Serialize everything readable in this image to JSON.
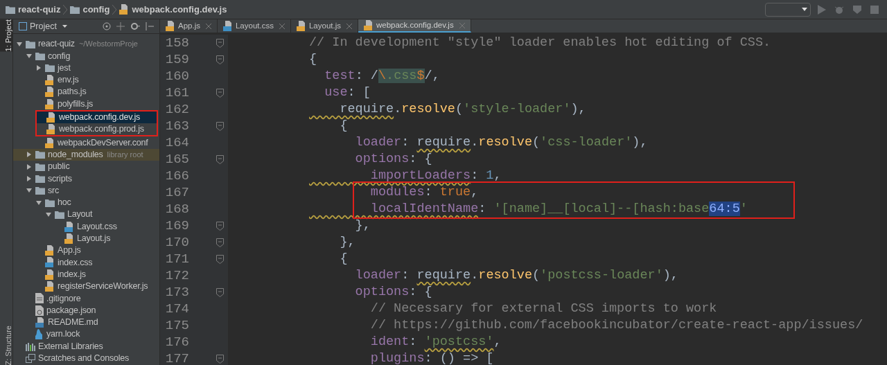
{
  "breadcrumbs": [
    {
      "label": "react-quiz",
      "kind": "folder"
    },
    {
      "label": "config",
      "kind": "folder"
    },
    {
      "label": "webpack.config.dev.js",
      "kind": "js"
    }
  ],
  "tool_strip": [
    {
      "label": "1: Project",
      "selected": true
    },
    {
      "label": "Z: Structure",
      "selected": false
    }
  ],
  "project_panel": {
    "title": "Project"
  },
  "tree": [
    {
      "label": "react-quiz",
      "kind": "folder",
      "expanded": true,
      "note": "~/WebstormProje",
      "children": [
        {
          "label": "config",
          "kind": "folder",
          "expanded": true,
          "children": [
            {
              "label": "jest",
              "kind": "folder",
              "expanded": false
            },
            {
              "label": "env.js",
              "kind": "js"
            },
            {
              "label": "paths.js",
              "kind": "js"
            },
            {
              "label": "polyfills.js",
              "kind": "js"
            },
            {
              "label": "webpack.config.dev.js",
              "kind": "js",
              "selected": true,
              "boxed": true
            },
            {
              "label": "webpack.config.prod.js",
              "kind": "js",
              "selected": false,
              "boxed": true
            },
            {
              "label": "webpackDevServer.conf",
              "kind": "js"
            }
          ]
        },
        {
          "label": "node_modules",
          "kind": "folder",
          "expanded": false,
          "note": "library root",
          "library": true
        },
        {
          "label": "public",
          "kind": "folder",
          "expanded": false,
          "library": false
        },
        {
          "label": "scripts",
          "kind": "folder",
          "expanded": false,
          "library": false
        },
        {
          "label": "src",
          "kind": "folder",
          "expanded": true,
          "children": [
            {
              "label": "hoc",
              "kind": "folder",
              "expanded": true,
              "children": [
                {
                  "label": "Layout",
                  "kind": "folder",
                  "expanded": true,
                  "children": [
                    {
                      "label": "Layout.css",
                      "kind": "css"
                    },
                    {
                      "label": "Layout.js",
                      "kind": "js"
                    }
                  ]
                }
              ]
            },
            {
              "label": "App.js",
              "kind": "js"
            },
            {
              "label": "index.css",
              "kind": "css"
            },
            {
              "label": "index.js",
              "kind": "js"
            },
            {
              "label": "registerServiceWorker.js",
              "kind": "js"
            }
          ]
        },
        {
          "label": ".gitignore",
          "kind": "text"
        },
        {
          "label": "package.json",
          "kind": "json"
        },
        {
          "label": "README.md",
          "kind": "md"
        },
        {
          "label": "yarn.lock",
          "kind": "yarn"
        }
      ]
    },
    {
      "label": "External Libraries",
      "kind": "libs"
    },
    {
      "label": "Scratches and Consoles",
      "kind": "scratches"
    }
  ],
  "tabs": [
    {
      "label": "App.js",
      "kind": "js",
      "selected": false
    },
    {
      "label": "Layout.css",
      "kind": "css",
      "selected": false
    },
    {
      "label": "Layout.js",
      "kind": "js",
      "selected": false
    },
    {
      "label": "webpack.config.dev.js",
      "kind": "js",
      "selected": true
    }
  ],
  "code": [
    {
      "number": "158",
      "fold": true,
      "tokens": [
        {
          "t": "// In development \"style\" loader enables hot editing of CSS.",
          "kind": "comment"
        }
      ]
    },
    {
      "number": "159",
      "fold": true,
      "tokens": [
        {
          "t": "{",
          "kind": "p"
        }
      ]
    },
    {
      "number": "160",
      "fold": false,
      "tokens": [
        {
          "t": "  test",
          "kind": "key"
        },
        {
          "t": ": /",
          "kind": "p"
        },
        {
          "t": "\\",
          "kind": "esc",
          "hl": true
        },
        {
          "t": ".css",
          "kind": "str",
          "hl": true
        },
        {
          "t": "$",
          "kind": "esc",
          "hl": true
        },
        {
          "t": "/,",
          "kind": "p"
        }
      ]
    },
    {
      "number": "161",
      "fold": true,
      "tokens": [
        {
          "t": "  use",
          "kind": "key"
        },
        {
          "t": ": [",
          "kind": "p"
        }
      ]
    },
    {
      "number": "162",
      "fold": false,
      "tokens": [
        {
          "t": "    require",
          "kind": "p",
          "squiggle": true
        },
        {
          "t": ".",
          "kind": "p"
        },
        {
          "t": "resolve",
          "kind": "fn"
        },
        {
          "t": "(",
          "kind": "p"
        },
        {
          "t": "'style-loader'",
          "kind": "str"
        },
        {
          "t": "),",
          "kind": "p"
        }
      ]
    },
    {
      "number": "163",
      "fold": true,
      "tokens": [
        {
          "t": "    {",
          "kind": "p"
        }
      ]
    },
    {
      "number": "164",
      "fold": false,
      "tokens": [
        {
          "t": "      loader",
          "kind": "key"
        },
        {
          "t": ": ",
          "kind": "p"
        },
        {
          "t": "require",
          "kind": "p",
          "squiggle": true
        },
        {
          "t": ".",
          "kind": "p"
        },
        {
          "t": "resolve",
          "kind": "fn"
        },
        {
          "t": "(",
          "kind": "p"
        },
        {
          "t": "'css-loader'",
          "kind": "str"
        },
        {
          "t": "),",
          "kind": "p"
        }
      ]
    },
    {
      "number": "165",
      "fold": true,
      "tokens": [
        {
          "t": "      options",
          "kind": "key"
        },
        {
          "t": ": {",
          "kind": "p"
        }
      ]
    },
    {
      "number": "166",
      "fold": false,
      "tokens": [
        {
          "t": "        importLoaders",
          "kind": "key",
          "squiggle": true
        },
        {
          "t": ": ",
          "kind": "p"
        },
        {
          "t": "1",
          "kind": "num"
        },
        {
          "t": ",",
          "kind": "p"
        }
      ]
    },
    {
      "number": "167",
      "fold": false,
      "boxed": true,
      "tokens": [
        {
          "t": "        modules",
          "kind": "key"
        },
        {
          "t": ": ",
          "kind": "p"
        },
        {
          "t": "true",
          "kind": "kw"
        },
        {
          "t": ",",
          "kind": "p"
        }
      ]
    },
    {
      "number": "168",
      "fold": false,
      "boxed": true,
      "tokens": [
        {
          "t": "        localIdentName",
          "kind": "key",
          "squiggle": true
        },
        {
          "t": ": ",
          "kind": "p"
        },
        {
          "t": "'[name]__[local]--[hash:base",
          "kind": "str"
        },
        {
          "t": "64:5",
          "kind": "str",
          "selected": true
        },
        {
          "t": "'",
          "kind": "str"
        }
      ]
    },
    {
      "number": "169",
      "fold": true,
      "tokens": [
        {
          "t": "      },",
          "kind": "p"
        }
      ]
    },
    {
      "number": "170",
      "fold": true,
      "tokens": [
        {
          "t": "    },",
          "kind": "p"
        }
      ]
    },
    {
      "number": "171",
      "fold": true,
      "tokens": [
        {
          "t": "    {",
          "kind": "p"
        }
      ]
    },
    {
      "number": "172",
      "fold": false,
      "tokens": [
        {
          "t": "      loader",
          "kind": "key"
        },
        {
          "t": ": ",
          "kind": "p"
        },
        {
          "t": "require",
          "kind": "p",
          "squiggle": true
        },
        {
          "t": ".",
          "kind": "p"
        },
        {
          "t": "resolve",
          "kind": "fn"
        },
        {
          "t": "(",
          "kind": "p"
        },
        {
          "t": "'postcss-loader'",
          "kind": "str"
        },
        {
          "t": "),",
          "kind": "p"
        }
      ]
    },
    {
      "number": "173",
      "fold": true,
      "tokens": [
        {
          "t": "      options",
          "kind": "key"
        },
        {
          "t": ": {",
          "kind": "p"
        }
      ]
    },
    {
      "number": "174",
      "fold": false,
      "tokens": [
        {
          "t": "        // Necessary for external CSS imports to work",
          "kind": "comment"
        }
      ]
    },
    {
      "number": "175",
      "fold": false,
      "tokens": [
        {
          "t": "        // https://github.com/facebookincubator/create-react-app/issues/",
          "kind": "comment"
        }
      ]
    },
    {
      "number": "176",
      "fold": false,
      "tokens": [
        {
          "t": "        ident",
          "kind": "key"
        },
        {
          "t": ": ",
          "kind": "p"
        },
        {
          "t": "'postcss'",
          "kind": "str",
          "squiggle": true
        },
        {
          "t": ",",
          "kind": "p"
        }
      ]
    },
    {
      "number": "177",
      "fold": true,
      "tokens": [
        {
          "t": "        plugins",
          "kind": "key"
        },
        {
          "t": ": () => [",
          "kind": "p"
        }
      ]
    }
  ]
}
